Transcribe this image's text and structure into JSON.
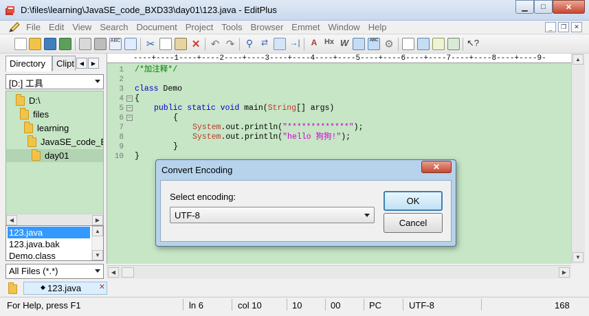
{
  "window": {
    "title": "D:\\files\\learning\\JavaSE_code_BXD33\\day01\\123.java - EditPlus"
  },
  "menu": [
    "File",
    "Edit",
    "View",
    "Search",
    "Document",
    "Project",
    "Tools",
    "Browser",
    "Emmet",
    "Window",
    "Help"
  ],
  "left_panel": {
    "tabs": [
      "Directory",
      "Clipt"
    ],
    "drive": "[D:] 工具",
    "tree": [
      "D:\\",
      "files",
      "learning",
      "JavaSE_code_BX",
      "day01"
    ],
    "files": [
      "123.java",
      "123.java.bak",
      "Demo.class"
    ],
    "filter": "All Files (*.*)"
  },
  "ruler": "----+----1----+----2----+----3----+----4----+----5----+----6----+----7----+----8----+----9-",
  "code": {
    "line_numbers": [
      "1",
      "2",
      "3",
      "4",
      "5",
      "6",
      "7",
      "8",
      "9",
      "10"
    ],
    "l1": "/*加注释*/",
    "l3_kw": "class",
    "l3_rest": " Demo",
    "l4": "{",
    "l5_kw1": "public static void",
    "l5_mid": " main(",
    "l5_cls": "String",
    "l5_end": "[] args)",
    "l6": "{",
    "l7_cls": "System",
    "l7_mid": ".out.println(",
    "l7_str": "\"*************\"",
    "l7_end": ");",
    "l8_cls": "System",
    "l8_mid": ".out.println(",
    "l8_str": "\"hello 狗狗!\"",
    "l8_end": ");",
    "l9": "}",
    "l10": "}"
  },
  "doc_tab": "123.java",
  "status": {
    "help": "For Help, press F1",
    "line": "ln 6",
    "col": "col 10",
    "sel": "10",
    "chr": "00",
    "eol": "PC",
    "enc": "UTF-8",
    "size": "168"
  },
  "dialog": {
    "title": "Convert Encoding",
    "label": "Select encoding:",
    "value": "UTF-8",
    "ok": "OK",
    "cancel": "Cancel"
  }
}
